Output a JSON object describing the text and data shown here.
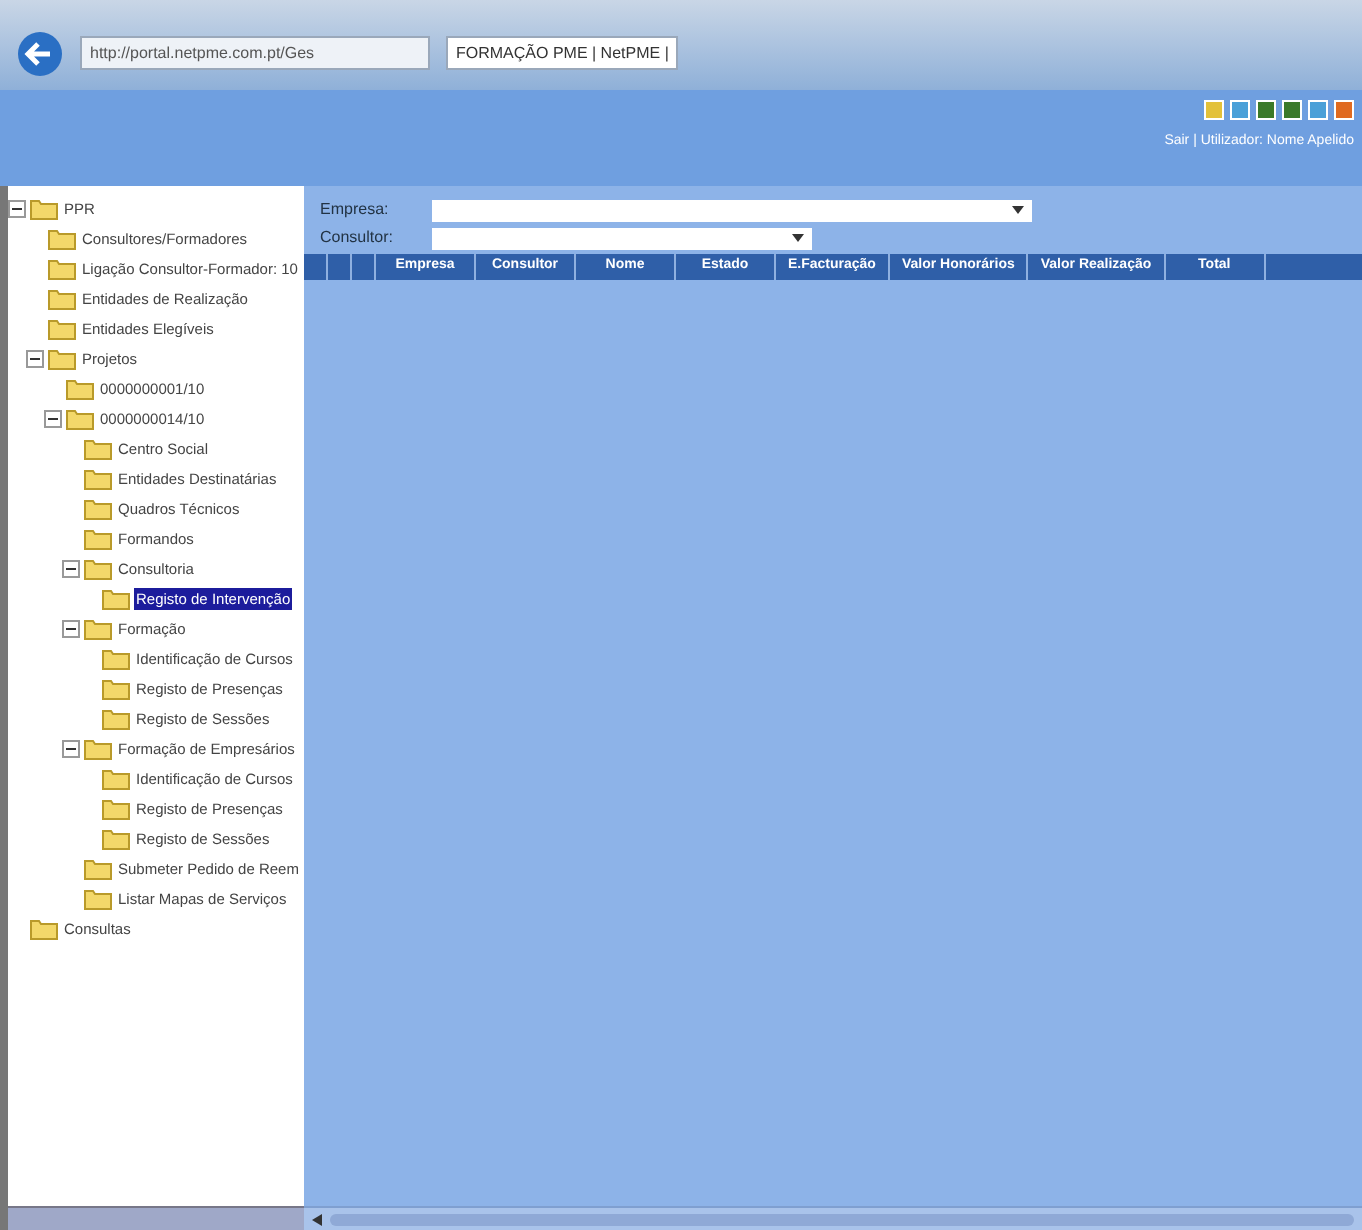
{
  "browser": {
    "address": "http://portal.netpme.com.pt/Ges",
    "tab_title": "FORMAÇÃO PME | NetPME |"
  },
  "header": {
    "user_line": "Sair | Utilizador: Nome Apelido"
  },
  "tree": [
    {
      "label": "PPR",
      "selected": false,
      "children": [
        {
          "label": "Consultores/Formadores",
          "selected": false
        },
        {
          "label": "Ligação Consultor-Formador: 10",
          "selected": false
        },
        {
          "label": "Entidades de Realização",
          "selected": false
        },
        {
          "label": "Entidades Elegíveis",
          "selected": false
        },
        {
          "label": "Projetos",
          "selected": false,
          "children": [
            {
              "label": "0000000001/10",
              "selected": false
            },
            {
              "label": "0000000014/10",
              "selected": false,
              "children": [
                {
                  "label": "Centro Social",
                  "selected": false
                },
                {
                  "label": "Entidades Destinatárias",
                  "selected": false
                },
                {
                  "label": "Quadros Técnicos",
                  "selected": false
                },
                {
                  "label": "Formandos",
                  "selected": false
                },
                {
                  "label": "Consultoria",
                  "selected": false,
                  "children": [
                    {
                      "label": "Registo de Intervenção",
                      "selected": true
                    }
                  ]
                },
                {
                  "label": "Formação",
                  "selected": false,
                  "children": [
                    {
                      "label": "Identificação de Cursos",
                      "selected": false
                    },
                    {
                      "label": "Registo de Presenças",
                      "selected": false
                    },
                    {
                      "label": "Registo de Sessões",
                      "selected": false
                    }
                  ]
                },
                {
                  "label": "Formação de Empresários",
                  "selected": false,
                  "children": [
                    {
                      "label": "Identificação de Cursos",
                      "selected": false
                    },
                    {
                      "label": "Registo de Presenças",
                      "selected": false
                    },
                    {
                      "label": "Registo de Sessões",
                      "selected": false
                    }
                  ]
                },
                {
                  "label": "Submeter Pedido de Reem",
                  "selected": false
                },
                {
                  "label": "Listar Mapas de Serviços",
                  "selected": false
                }
              ]
            }
          ]
        }
      ]
    },
    {
      "label": "Consultas",
      "selected": false
    }
  ],
  "filters": [
    {
      "label": "Empresa:"
    },
    {
      "label": "Consultor:"
    }
  ],
  "table": {
    "columns": [
      "Empresa",
      "Consultor",
      "Nome",
      "Estado",
      "E.Facturação",
      "Valor Honorários",
      "Valor Realização",
      "Total"
    ]
  }
}
